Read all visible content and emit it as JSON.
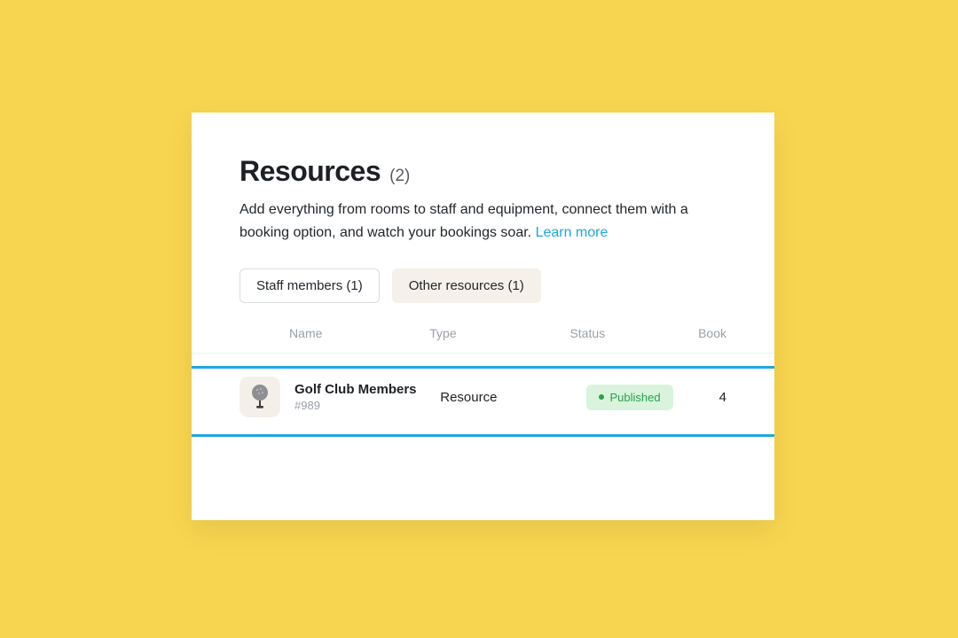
{
  "header": {
    "title": "Resources",
    "count": "(2)",
    "description_text": "Add everything from rooms to staff and equipment, connect them with a booking option, and watch your bookings soar. ",
    "learn_more": "Learn more"
  },
  "tabs": [
    {
      "label": "Staff members (1)",
      "active": false
    },
    {
      "label": "Other resources (1)",
      "active": true
    }
  ],
  "columns": {
    "name": "Name",
    "type": "Type",
    "status": "Status",
    "book": "Book"
  },
  "rows": [
    {
      "name": "Golf Club Members",
      "id": "#989",
      "type": "Resource",
      "status": "Published",
      "book": "4"
    }
  ]
}
